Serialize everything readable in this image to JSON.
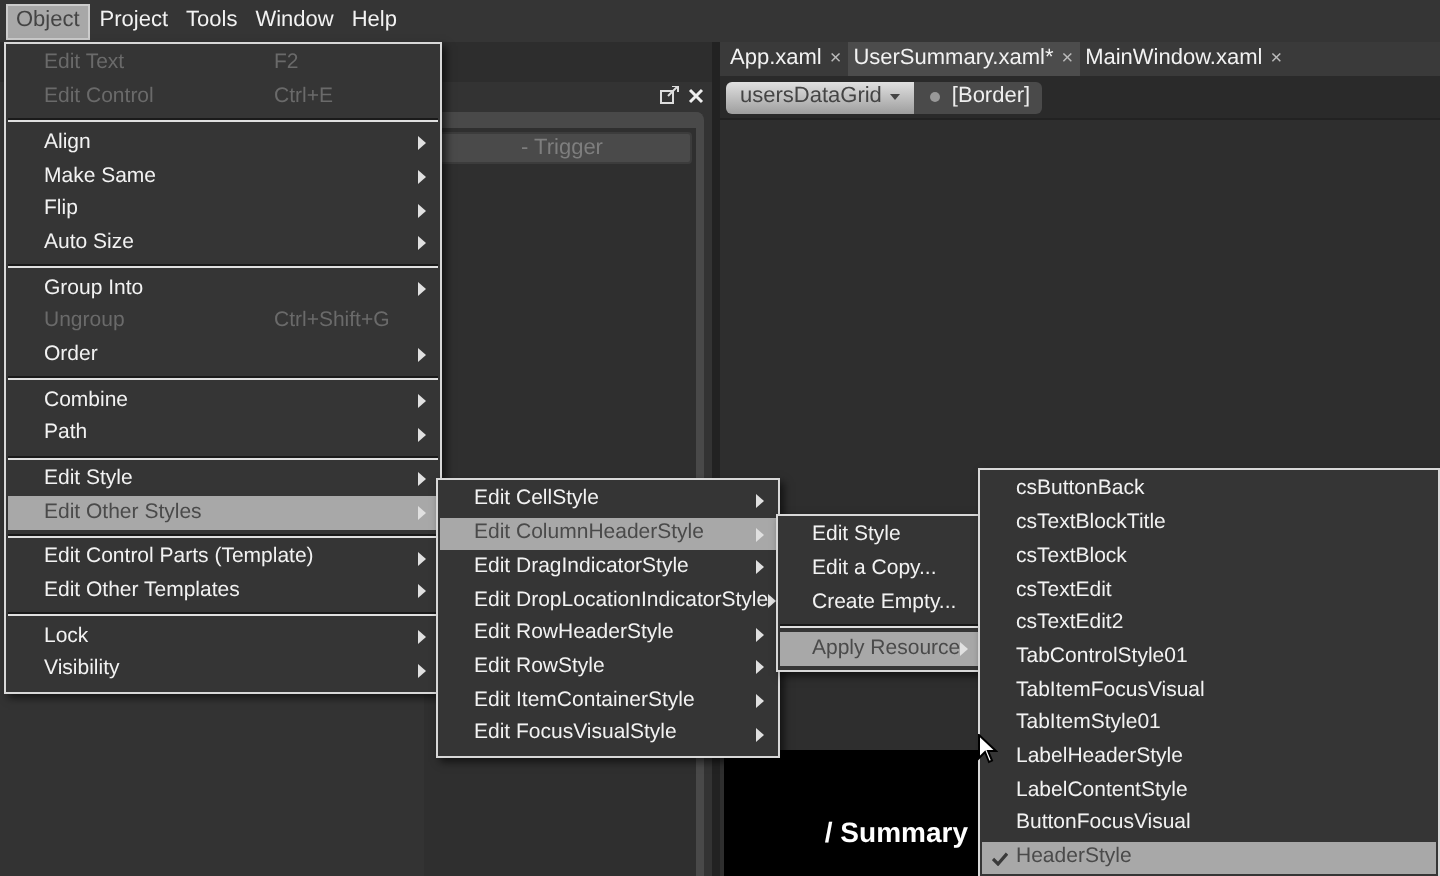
{
  "menubar": [
    {
      "label": "Object",
      "selected": true
    },
    {
      "label": "Project",
      "selected": false
    },
    {
      "label": "Tools",
      "selected": false
    },
    {
      "label": "Window",
      "selected": false
    },
    {
      "label": "Help",
      "selected": false
    }
  ],
  "left_panel": {
    "trigger_button": "- Trigger"
  },
  "tabs": [
    {
      "label": "App.xaml",
      "close": "×",
      "selected": false
    },
    {
      "label": "UserSummary.xaml*",
      "close": "×",
      "selected": true
    },
    {
      "label": "MainWindow.xaml",
      "close": "×",
      "selected": false
    }
  ],
  "breadcrumb": {
    "element": "usersDataGrid",
    "child": "[Border]"
  },
  "canvas": {
    "heading": "/ Summary"
  },
  "menus": [
    {
      "items": [
        {
          "kind": "item",
          "label": "Edit Text",
          "shortcut": "F2",
          "disabled": true,
          "submenu": false,
          "selected": false
        },
        {
          "kind": "item",
          "label": "Edit Control",
          "shortcut": "Ctrl+E",
          "disabled": true,
          "submenu": false,
          "selected": false
        },
        {
          "kind": "separator"
        },
        {
          "kind": "item",
          "label": "Align",
          "disabled": false,
          "submenu": true,
          "selected": false
        },
        {
          "kind": "item",
          "label": "Make Same",
          "disabled": false,
          "submenu": true,
          "selected": false
        },
        {
          "kind": "item",
          "label": "Flip",
          "disabled": false,
          "submenu": true,
          "selected": false
        },
        {
          "kind": "item",
          "label": "Auto Size",
          "disabled": false,
          "submenu": true,
          "selected": false
        },
        {
          "kind": "separator"
        },
        {
          "kind": "item",
          "label": "Group Into",
          "disabled": false,
          "submenu": true,
          "selected": false
        },
        {
          "kind": "item",
          "label": "Ungroup",
          "shortcut": "Ctrl+Shift+G",
          "disabled": true,
          "submenu": false,
          "selected": false
        },
        {
          "kind": "item",
          "label": "Order",
          "disabled": false,
          "submenu": true,
          "selected": false
        },
        {
          "kind": "separator"
        },
        {
          "kind": "item",
          "label": "Combine",
          "disabled": false,
          "submenu": true,
          "selected": false
        },
        {
          "kind": "item",
          "label": "Path",
          "disabled": false,
          "submenu": true,
          "selected": false
        },
        {
          "kind": "separator"
        },
        {
          "kind": "item",
          "label": "Edit Style",
          "disabled": false,
          "submenu": true,
          "selected": false
        },
        {
          "kind": "item",
          "label": "Edit Other Styles",
          "disabled": false,
          "submenu": true,
          "selected": true
        },
        {
          "kind": "separator"
        },
        {
          "kind": "item",
          "label": "Edit Control Parts (Template)",
          "disabled": false,
          "submenu": true,
          "selected": false
        },
        {
          "kind": "item",
          "label": "Edit Other Templates",
          "disabled": false,
          "submenu": true,
          "selected": false
        },
        {
          "kind": "separator"
        },
        {
          "kind": "item",
          "label": "Lock",
          "disabled": false,
          "submenu": true,
          "selected": false
        },
        {
          "kind": "item",
          "label": "Visibility",
          "disabled": false,
          "submenu": true,
          "selected": false
        }
      ]
    },
    {
      "items": [
        {
          "kind": "item",
          "label": "Edit CellStyle",
          "disabled": false,
          "submenu": true,
          "selected": false
        },
        {
          "kind": "item",
          "label": "Edit ColumnHeaderStyle",
          "disabled": false,
          "submenu": true,
          "selected": true
        },
        {
          "kind": "item",
          "label": "Edit DragIndicatorStyle",
          "disabled": false,
          "submenu": true,
          "selected": false
        },
        {
          "kind": "item",
          "label": "Edit DropLocationIndicatorStyle",
          "disabled": false,
          "submenu": true,
          "selected": false
        },
        {
          "kind": "item",
          "label": "Edit RowHeaderStyle",
          "disabled": false,
          "submenu": true,
          "selected": false
        },
        {
          "kind": "item",
          "label": "Edit RowStyle",
          "disabled": false,
          "submenu": true,
          "selected": false
        },
        {
          "kind": "item",
          "label": "Edit ItemContainerStyle",
          "disabled": false,
          "submenu": true,
          "selected": false
        },
        {
          "kind": "item",
          "label": "Edit FocusVisualStyle",
          "disabled": false,
          "submenu": true,
          "selected": false
        }
      ]
    },
    {
      "items": [
        {
          "kind": "item",
          "label": "Edit Style",
          "disabled": false,
          "submenu": false,
          "selected": false
        },
        {
          "kind": "item",
          "label": "Edit a Copy...",
          "disabled": false,
          "submenu": false,
          "selected": false
        },
        {
          "kind": "item",
          "label": "Create Empty...",
          "disabled": false,
          "submenu": false,
          "selected": false
        },
        {
          "kind": "separator"
        },
        {
          "kind": "item",
          "label": "Apply Resource",
          "disabled": false,
          "submenu": true,
          "selected": true
        }
      ]
    },
    {
      "items": [
        {
          "kind": "item",
          "label": "csButtonBack",
          "disabled": false,
          "submenu": false,
          "selected": false,
          "checked": false
        },
        {
          "kind": "item",
          "label": "csTextBlockTitle",
          "disabled": false,
          "submenu": false,
          "selected": false,
          "checked": false
        },
        {
          "kind": "item",
          "label": "csTextBlock",
          "disabled": false,
          "submenu": false,
          "selected": false,
          "checked": false
        },
        {
          "kind": "item",
          "label": "csTextEdit",
          "disabled": false,
          "submenu": false,
          "selected": false,
          "checked": false
        },
        {
          "kind": "item",
          "label": "csTextEdit2",
          "disabled": false,
          "submenu": false,
          "selected": false,
          "checked": false
        },
        {
          "kind": "item",
          "label": "TabControlStyle01",
          "disabled": false,
          "submenu": false,
          "selected": false,
          "checked": false
        },
        {
          "kind": "item",
          "label": "TabItemFocusVisual",
          "disabled": false,
          "submenu": false,
          "selected": false,
          "checked": false
        },
        {
          "kind": "item",
          "label": "TabItemStyle01",
          "disabled": false,
          "submenu": false,
          "selected": false,
          "checked": false
        },
        {
          "kind": "item",
          "label": "LabelHeaderStyle",
          "disabled": false,
          "submenu": false,
          "selected": false,
          "checked": false
        },
        {
          "kind": "item",
          "label": "LabelContentStyle",
          "disabled": false,
          "submenu": false,
          "selected": false,
          "checked": false
        },
        {
          "kind": "item",
          "label": "ButtonFocusVisual",
          "disabled": false,
          "submenu": false,
          "selected": false,
          "checked": false
        },
        {
          "kind": "item",
          "label": "HeaderStyle",
          "disabled": false,
          "submenu": false,
          "selected": true,
          "checked": true
        }
      ]
    }
  ]
}
